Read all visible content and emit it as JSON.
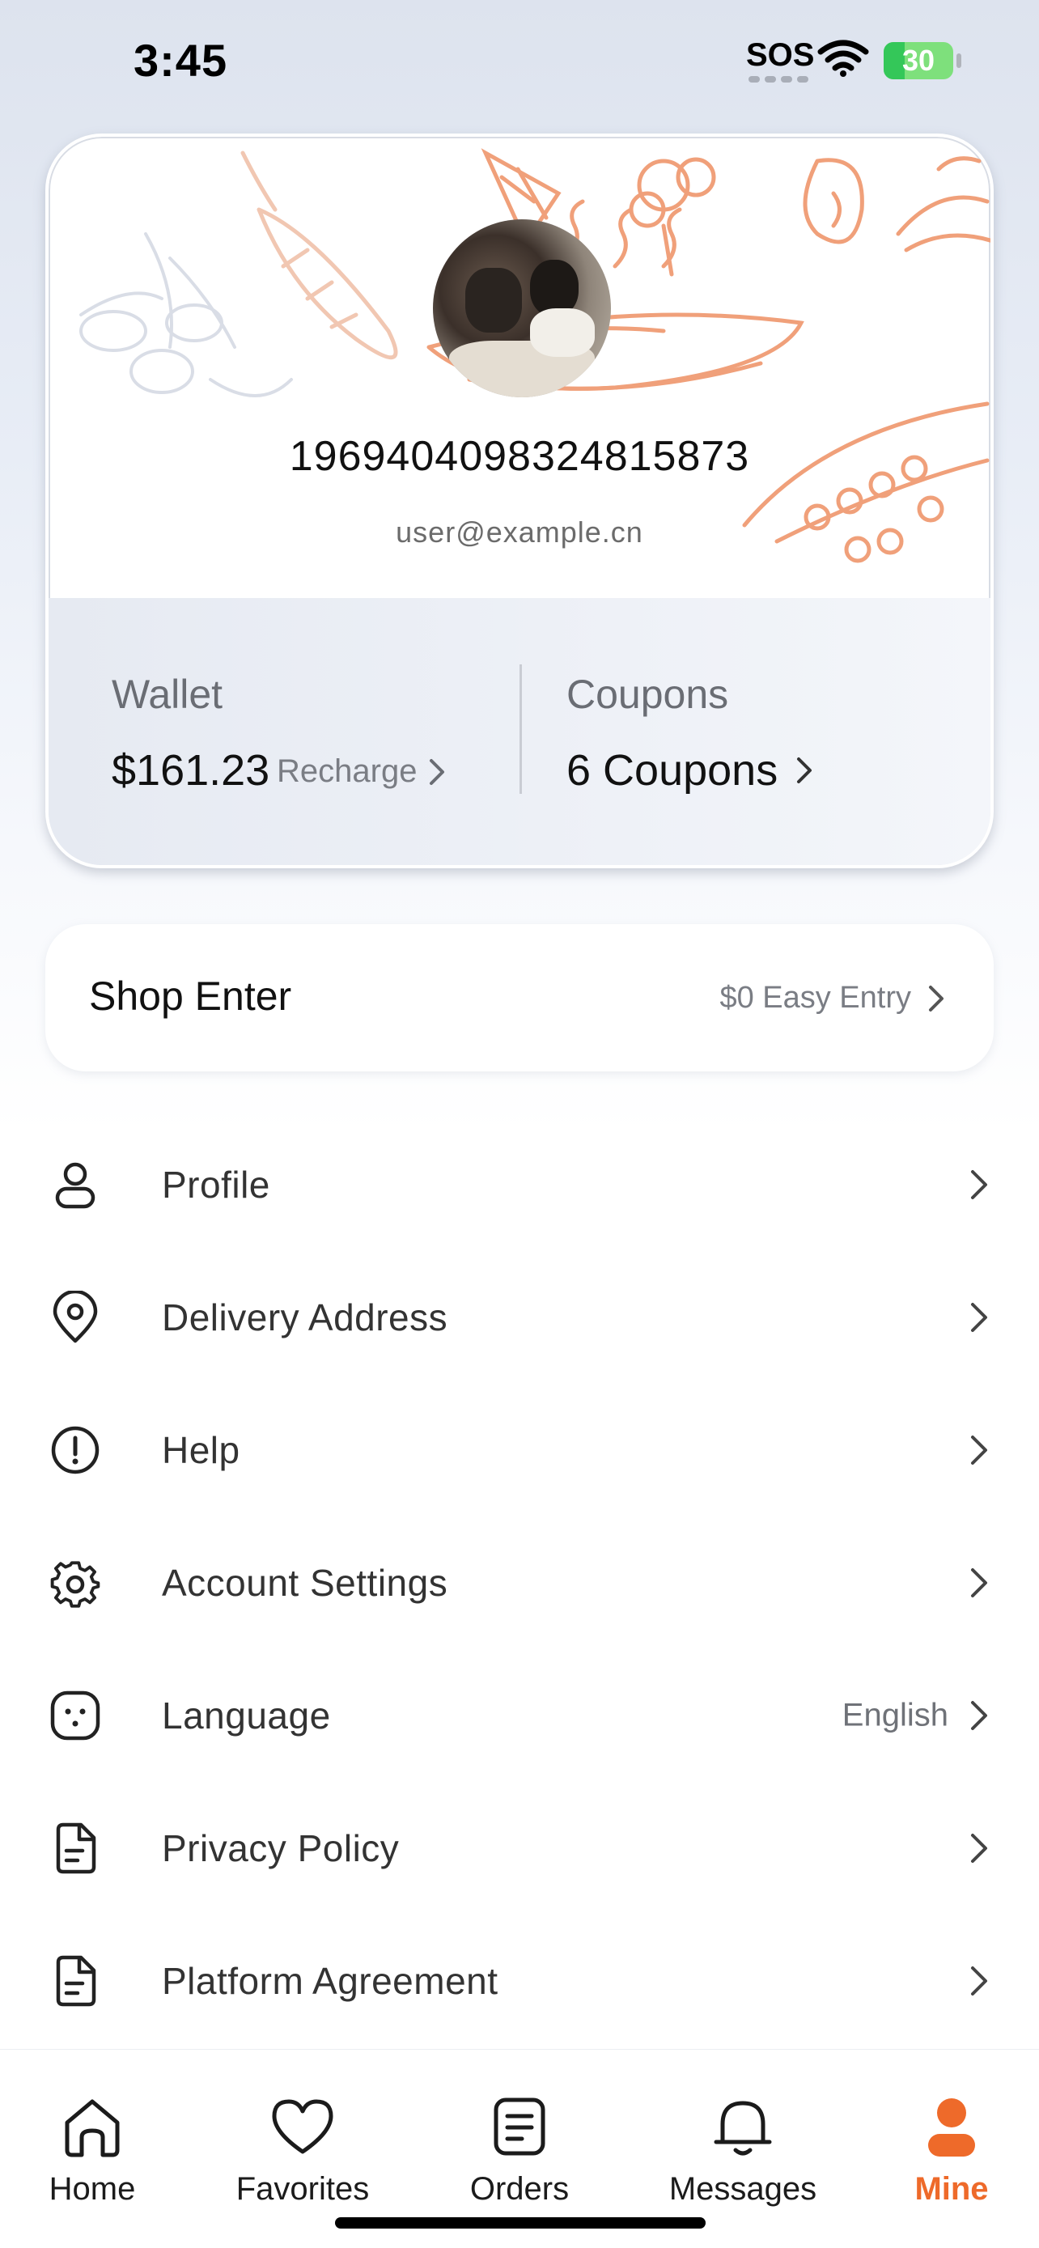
{
  "status_bar": {
    "time": "3:45",
    "sos": "SOS",
    "battery": "30",
    "battery_level": 0.3
  },
  "profile": {
    "user_id": "1969404098324815873",
    "email": "user@example.cn",
    "wallet_label": "Wallet",
    "wallet_value": "$161.23",
    "recharge_label": "Recharge",
    "coupons_label": "Coupons",
    "coupons_value": "6 Coupons"
  },
  "shop": {
    "title": "Shop Enter",
    "subtitle": "$0 Easy Entry"
  },
  "menu": {
    "items": [
      {
        "label": "Profile",
        "icon": "person-icon"
      },
      {
        "label": "Delivery Address",
        "icon": "location-pin-icon"
      },
      {
        "label": "Help",
        "icon": "exclamation-circle-icon"
      },
      {
        "label": "Account Settings",
        "icon": "gear-icon"
      },
      {
        "label": "Language",
        "icon": "language-icon",
        "value": "English"
      },
      {
        "label": "Privacy Policy",
        "icon": "document-icon"
      },
      {
        "label": "Platform Agreement",
        "icon": "document-icon"
      }
    ]
  },
  "tabs": [
    {
      "label": "Home",
      "icon": "home-icon"
    },
    {
      "label": "Favorites",
      "icon": "heart-icon"
    },
    {
      "label": "Orders",
      "icon": "orders-icon"
    },
    {
      "label": "Messages",
      "icon": "bell-icon"
    },
    {
      "label": "Mine",
      "icon": "person-filled-icon",
      "active": true
    }
  ],
  "colors": {
    "accent": "#ee6a2a",
    "doodle": "#f0a07a",
    "doodle_faint": "#d9dde6"
  }
}
